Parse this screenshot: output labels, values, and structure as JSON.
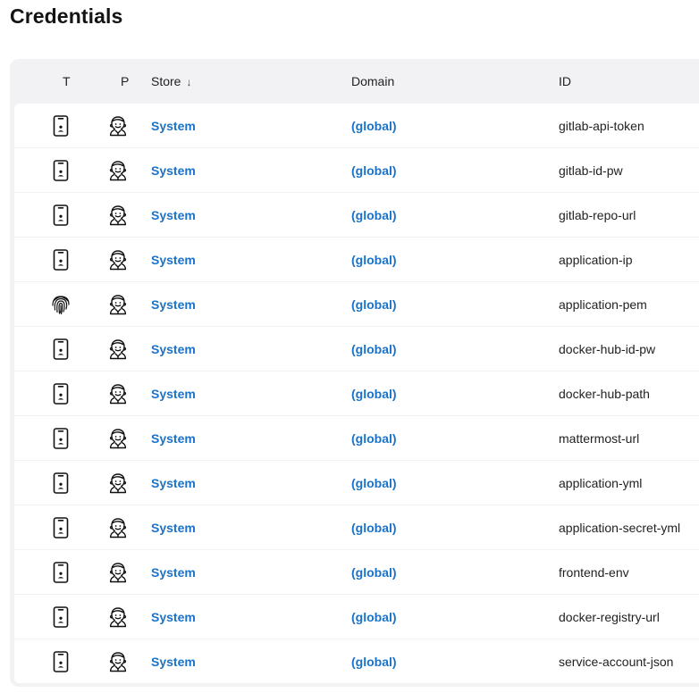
{
  "page": {
    "title": "Credentials"
  },
  "table": {
    "headers": {
      "type": "T",
      "provider": "P",
      "store": "Store",
      "store_sort": "↓",
      "domain": "Domain",
      "id": "ID"
    },
    "rows": [
      {
        "type_icon": "phone-icon",
        "provider_icon": "jenkins-icon",
        "store": "System",
        "domain": "(global)",
        "id": "gitlab-api-token"
      },
      {
        "type_icon": "phone-icon",
        "provider_icon": "jenkins-icon",
        "store": "System",
        "domain": "(global)",
        "id": "gitlab-id-pw"
      },
      {
        "type_icon": "phone-icon",
        "provider_icon": "jenkins-icon",
        "store": "System",
        "domain": "(global)",
        "id": "gitlab-repo-url"
      },
      {
        "type_icon": "phone-icon",
        "provider_icon": "jenkins-icon",
        "store": "System",
        "domain": "(global)",
        "id": "application-ip"
      },
      {
        "type_icon": "fingerprint-icon",
        "provider_icon": "jenkins-icon",
        "store": "System",
        "domain": "(global)",
        "id": "application-pem"
      },
      {
        "type_icon": "phone-icon",
        "provider_icon": "jenkins-icon",
        "store": "System",
        "domain": "(global)",
        "id": "docker-hub-id-pw"
      },
      {
        "type_icon": "phone-icon",
        "provider_icon": "jenkins-icon",
        "store": "System",
        "domain": "(global)",
        "id": "docker-hub-path"
      },
      {
        "type_icon": "phone-icon",
        "provider_icon": "jenkins-icon",
        "store": "System",
        "domain": "(global)",
        "id": "mattermost-url"
      },
      {
        "type_icon": "phone-icon",
        "provider_icon": "jenkins-icon",
        "store": "System",
        "domain": "(global)",
        "id": "application-yml"
      },
      {
        "type_icon": "phone-icon",
        "provider_icon": "jenkins-icon",
        "store": "System",
        "domain": "(global)",
        "id": "application-secret-yml"
      },
      {
        "type_icon": "phone-icon",
        "provider_icon": "jenkins-icon",
        "store": "System",
        "domain": "(global)",
        "id": "frontend-env"
      },
      {
        "type_icon": "phone-icon",
        "provider_icon": "jenkins-icon",
        "store": "System",
        "domain": "(global)",
        "id": "docker-registry-url"
      },
      {
        "type_icon": "phone-icon",
        "provider_icon": "jenkins-icon",
        "store": "System",
        "domain": "(global)",
        "id": "service-account-json"
      }
    ]
  },
  "colors": {
    "link": "#1a73c8",
    "table_bg": "#f2f2f5",
    "row_bg": "#ffffff"
  }
}
